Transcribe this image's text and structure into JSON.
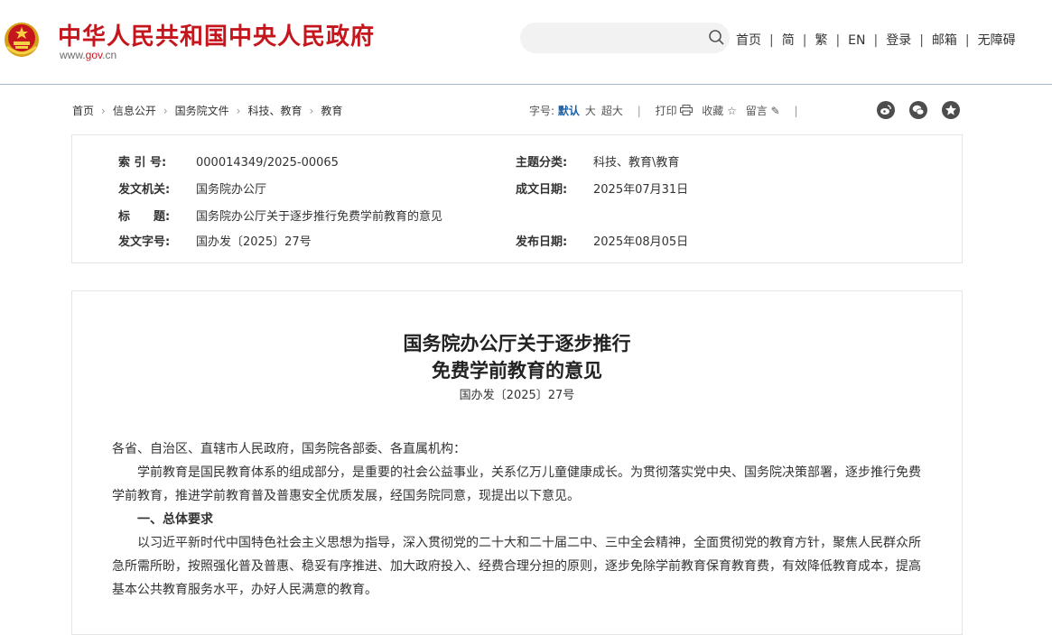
{
  "header": {
    "site_name": "中华人民共和国中央人民政府",
    "site_url_prefix": "www.",
    "site_url_brand": "gov",
    "site_url_suffix": ".cn",
    "brand_color": "#c4161c",
    "search": {
      "placeholder": "",
      "icon": "search-icon"
    },
    "links": [
      "首页",
      "简",
      "繁",
      "EN",
      "登录",
      "邮箱",
      "无障碍"
    ]
  },
  "breadcrumb": {
    "items": [
      "首页",
      "信息公开",
      "国务院文件",
      "科技、教育",
      "教育"
    ],
    "separator": "›"
  },
  "toolbar": {
    "font_size_label": "字号:",
    "font_sizes": [
      "默认",
      "大",
      "超大"
    ],
    "print_label": "打印",
    "favorite_label": "收藏",
    "comment_label": "留言",
    "share_icons": [
      "weibo-icon",
      "wechat-icon",
      "qzone-icon"
    ]
  },
  "info": {
    "index_label": "索 引 号:",
    "index_value": "000014349/2025-00065",
    "topic_label": "主题分类:",
    "topic_value": "科技、教育\\教育",
    "issuer_label": "发文机关:",
    "issuer_value": "国务院办公厅",
    "date_written_label": "成文日期:",
    "date_written_value": "2025年07月31日",
    "title_label": "标　　题:",
    "title_value": "国务院办公厅关于逐步推行免费学前教育的意见",
    "docno_label": "发文字号:",
    "docno_value": "国办发〔2025〕27号",
    "date_published_label": "发布日期:",
    "date_published_value": "2025年08月05日"
  },
  "article": {
    "title_line1": "国务院办公厅关于逐步推行",
    "title_line2": "免费学前教育的意见",
    "doc_number": "国办发〔2025〕27号",
    "salutation": "各省、自治区、直辖市人民政府，国务院各部委、各直属机构：",
    "para1": "学前教育是国民教育体系的组成部分，是重要的社会公益事业，关系亿万儿童健康成长。为贯彻落实党中央、国务院决策部署，逐步推行免费学前教育，推进学前教育普及普惠安全优质发展，经国务院同意，现提出以下意见。",
    "section1": "一、总体要求",
    "para2": "以习近平新时代中国特色社会主义思想为指导，深入贯彻党的二十大和二十届二中、三中全会精神，全面贯彻党的教育方针，聚焦人民群众所急所需所盼，按照强化普及普惠、稳妥有序推进、加大政府投入、经费合理分担的原则，逐步免除学前教育保育教育费，有效降低教育成本，提高基本公共教育服务水平，办好人民满意的教育。"
  }
}
